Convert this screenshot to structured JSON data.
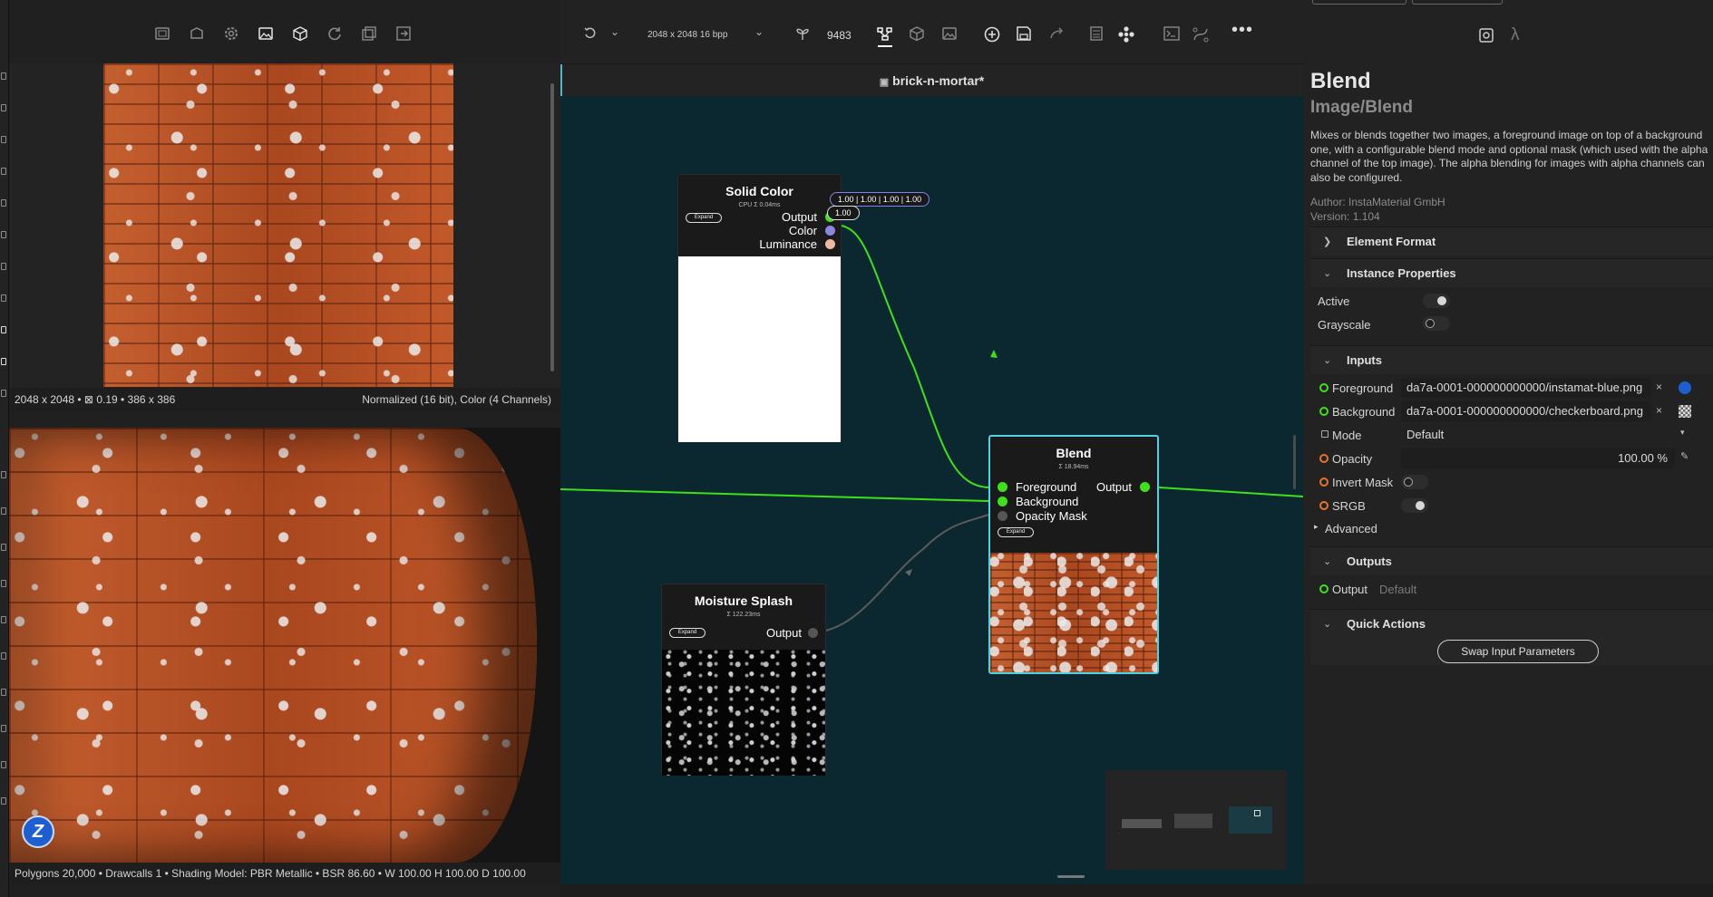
{
  "left_toolbar": {
    "icons": [
      "layers-icon",
      "box-open-icon",
      "gear-icon",
      "image-icon",
      "cube-icon",
      "refresh-icon",
      "copy-icon",
      "export-icon"
    ]
  },
  "texture_view": {
    "status_left": "2048 x 2048 • ⊠ 0.19 • 386 x 386",
    "status_right": "Normalized (16 bit), Color (4 Channels)"
  },
  "viewport_3d": {
    "logo_letter": "Z",
    "status": "Polygons 20,000 • Drawcalls 1 • Shading Model: PBR Metallic • BSR 86.60 • W 100.00 H 100.00 D 100.00"
  },
  "graph_toolbar": {
    "resolution": "2048 x 2048 16 bpp",
    "seed": "9483"
  },
  "graph": {
    "tab_title": "brick-n-mortar*",
    "nodes": {
      "solid_color": {
        "title": "Solid Color",
        "timing": "CPU Σ 0.04ms",
        "expand": "Expand",
        "ports": [
          "Output",
          "Color",
          "Luminance"
        ],
        "color_value": "1.00 | 1.00 | 1.00 | 1.00",
        "luminance_value": "1.00"
      },
      "blend": {
        "title": "Blend",
        "timing": "Σ 18.94ms",
        "expand": "Expand",
        "inputs": [
          "Foreground",
          "Background",
          "Opacity Mask"
        ],
        "output": "Output"
      },
      "moisture": {
        "title": "Moisture Splash",
        "timing": "Σ 122.23ms",
        "expand": "Expand",
        "output": "Output"
      }
    }
  },
  "properties": {
    "title": "Blend",
    "subtitle": "Image/Blend",
    "description": "Mixes or blends together two images, a foreground image on top of a background one, with a configurable blend mode and optional mask (which used with the alpha channel of the top image). The alpha blending for images with alpha channels can also be configured.",
    "author": "Author: InstaMaterial GmbH",
    "version": "Version: 1.104",
    "sections": {
      "element_format": "Element Format",
      "instance_properties": "Instance Properties",
      "inputs": "Inputs",
      "outputs": "Outputs",
      "quick_actions": "Quick Actions"
    },
    "instance": {
      "active_label": "Active",
      "active": true,
      "grayscale_label": "Grayscale",
      "grayscale": false
    },
    "inputs": {
      "foreground_label": "Foreground",
      "foreground_value": "da7a-0001-000000000000/instamat-blue.png",
      "background_label": "Background",
      "background_value": "da7a-0001-000000000000/checkerboard.png",
      "mode_label": "Mode",
      "mode_value": "Default",
      "opacity_label": "Opacity",
      "opacity_value": "100.00 %",
      "invert_mask_label": "Invert Mask",
      "invert_mask": false,
      "srgb_label": "SRGB",
      "srgb": true,
      "advanced_label": "Advanced",
      "clear_glyph": "×"
    },
    "outputs": {
      "output_label": "Output",
      "output_value": "Default"
    },
    "quick_actions": {
      "swap_button": "Swap Input Parameters"
    }
  },
  "colors": {
    "graph_bg": "#0b2730",
    "wire_green": "#3ee01c",
    "selection_cyan": "#4fd3e3",
    "port_green": "#3ee01c",
    "port_orange": "#e8732a"
  }
}
